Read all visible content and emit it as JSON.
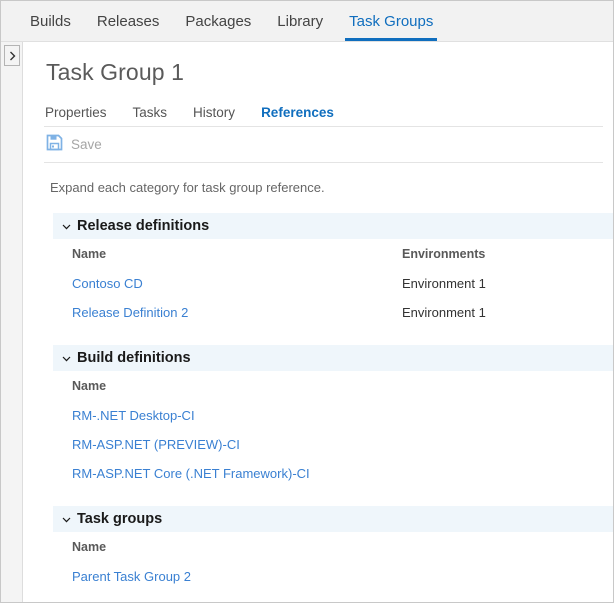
{
  "topnav": {
    "items": [
      {
        "label": "Builds",
        "active": false
      },
      {
        "label": "Releases",
        "active": false
      },
      {
        "label": "Packages",
        "active": false
      },
      {
        "label": "Library",
        "active": false
      },
      {
        "label": "Task Groups",
        "active": true
      }
    ],
    "active_color": "#106ebe"
  },
  "rail": {
    "toggle_icon": "chevron-right-icon"
  },
  "page": {
    "title": "Task Group 1"
  },
  "subtabs": {
    "items": [
      {
        "label": "Properties",
        "active": false
      },
      {
        "label": "Tasks",
        "active": false
      },
      {
        "label": "History",
        "active": false
      },
      {
        "label": "References",
        "active": true
      }
    ]
  },
  "toolbar": {
    "save_label": "Save",
    "save_icon": "save-floppy-icon",
    "save_icon_color": "#7fb2e5",
    "save_disabled": true
  },
  "body": {
    "hint": "Expand each category for task group reference.",
    "sections": [
      {
        "title": "Release definitions",
        "expanded": true,
        "columns": [
          "Name",
          "Environments"
        ],
        "rows": [
          {
            "name": "Contoso CD",
            "environments": "Environment 1"
          },
          {
            "name": "Release Definition 2",
            "environments": "Environment 1"
          }
        ]
      },
      {
        "title": "Build definitions",
        "expanded": true,
        "columns": [
          "Name"
        ],
        "rows": [
          {
            "name": "RM-.NET Desktop-CI"
          },
          {
            "name": "RM-ASP.NET (PREVIEW)-CI"
          },
          {
            "name": "RM-ASP.NET Core (.NET Framework)-CI"
          }
        ]
      },
      {
        "title": "Task groups",
        "expanded": true,
        "columns": [
          "Name"
        ],
        "rows": [
          {
            "name": "Parent Task Group 2"
          }
        ]
      }
    ]
  },
  "colors": {
    "link": "#3a80d2",
    "accent": "#106ebe",
    "section_band": "#eff6fb"
  }
}
